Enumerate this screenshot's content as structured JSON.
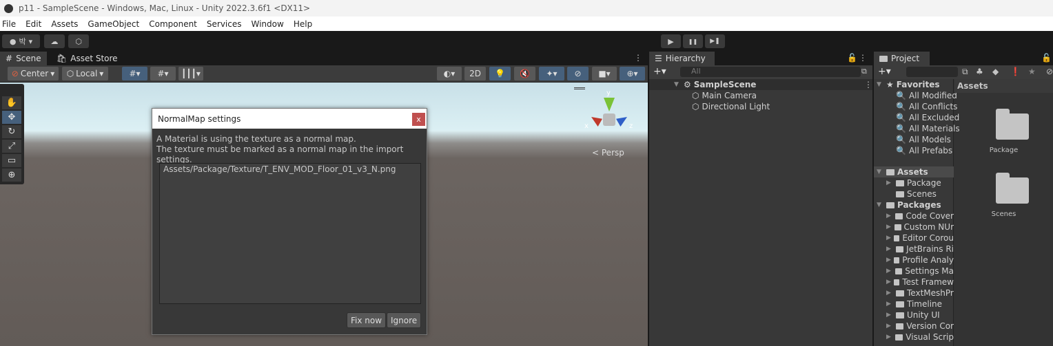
{
  "window": {
    "title": "p11 - SampleScene - Windows, Mac, Linux - Unity 2022.3.6f1 <DX11>"
  },
  "menu": [
    "File",
    "Edit",
    "Assets",
    "GameObject",
    "Component",
    "Services",
    "Window",
    "Help"
  ],
  "toolbar": {
    "account": "박",
    "play": "▶",
    "pause": "❚❚",
    "step": "▶❚"
  },
  "scene": {
    "tabs": [
      "Scene",
      "Asset Store"
    ],
    "pivot": "Center",
    "space": "Local",
    "mode2d": "2D",
    "persp": "Persp",
    "gizmo_axes": [
      "y",
      "x",
      "z"
    ]
  },
  "dialog": {
    "title": "NormalMap settings",
    "close": "x",
    "message": [
      "A Material is using the texture as a normal map.",
      "The texture must be marked as a normal map in the import settings."
    ],
    "items": [
      "Assets/Package/Texture/T_ENV_MOD_Floor_01_v3_N.png"
    ],
    "fix": "Fix now",
    "ignore": "Ignore"
  },
  "hierarchy": {
    "tab": "Hierarchy",
    "search_placeholder": "All",
    "scene": "SampleScene",
    "items": [
      "Main Camera",
      "Directional Light"
    ]
  },
  "project": {
    "tab": "Project",
    "favorites_label": "Favorites",
    "favorites": [
      "All Modified",
      "All Conflicts",
      "All Excluded",
      "All Materials",
      "All Models",
      "All Prefabs"
    ],
    "assets_label": "Assets",
    "assets": [
      "Package",
      "Scenes"
    ],
    "packages_label": "Packages",
    "packages": [
      "Code Cover",
      "Custom NUr",
      "Editor Corou",
      "JetBrains Ri",
      "Profile Analy",
      "Settings Ma",
      "Test Framew",
      "TextMeshPr",
      "Timeline",
      "Unity UI",
      "Version Cor",
      "Visual Scrip"
    ],
    "grid_header": "Assets",
    "grid_items": [
      "Package",
      "Scenes"
    ]
  },
  "colors": {
    "accent": "#46607c",
    "close": "#c0504f",
    "panel": "#383838"
  }
}
